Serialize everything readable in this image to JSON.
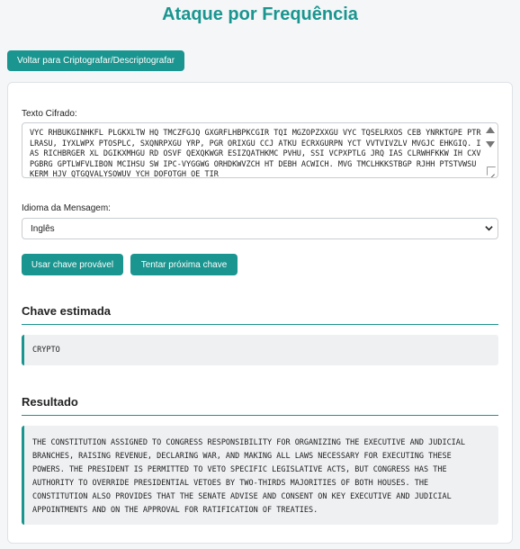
{
  "page": {
    "title": "Ataque por Frequência",
    "back_button": "Voltar para Criptografar/Descriptografar"
  },
  "form": {
    "cipher_label": "Texto Cifrado:",
    "cipher_text": "VYC RHBUKGINHKFL PLGKXLTW HQ TMCZFGJQ GXGRFLHBPKCGIR TQI MGZOPZXXGU VYC TQSELRXOS CEB YNRKTGPE PTRLRASU, IYXLWPX PTOSPLC, SXQNRPXGU YRP, PGR ORIXGU CCJ ATKU ECRXGURPN YCT VVTVIVZLV MVGJC EHKGIQ. IAS RICHBRGER XL DGIKXMHGU RD OSVF QEXQKWGR ESIZQATHKMC PVHU, SSI VCPXPTLG JRQ IAS CLRWHFKKW IH CXVPGBRG GPTLWFVLIBON MCIHSU SW IPC-VYGGWG ORHDKWVZCH HT DEBH ACWICH. MVG TMCLHKKSTBGP RJHH PTSTVWSU KERM HJV QTGQVALYSOWUV YCH DOFOTGH OE TIR",
    "language_label": "Idioma da Mensagem:",
    "language_selected": "Inglês",
    "use_key_button": "Usar chave provável",
    "next_key_button": "Tentar próxima chave"
  },
  "key_section": {
    "title": "Chave estimada",
    "value": "CRYPTO"
  },
  "result_section": {
    "title": "Resultado",
    "lines": [
      "THE CONSTITUTION ASSIGNED TO CONGRESS RESPONSIBILITY FOR ORGANIZING THE EXECUTIVE AND JUDICIAL",
      "BRANCHES, RAISING REVENUE, DECLARING WAR, AND MAKING ALL LAWS NECESSARY FOR EXECUTING THESE",
      "POWERS. THE PRESIDENT IS PERMITTED TO VETO SPECIFIC LEGISLATIVE ACTS, BUT CONGRESS HAS THE",
      "AUTHORITY TO OVERRIDE PRESIDENTIAL VETOES BY TWO-THIRDS MAJORITIES OF BOTH HOUSES. THE",
      "CONSTITUTION ALSO PROVIDES THAT THE SENATE ADVISE AND CONSENT ON KEY EXECUTIVE AND JUDICIAL",
      "APPOINTMENTS AND ON THE APPROVAL FOR RATIFICATION OF TREATIES."
    ]
  },
  "colors": {
    "accent": "#1a958f",
    "panel_bg": "#eef0f2"
  }
}
